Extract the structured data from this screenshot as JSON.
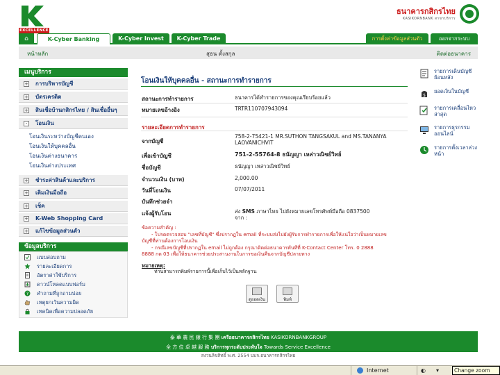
{
  "header": {
    "logo_excellence": "EXCELLENCE",
    "bank_name_th": "ธนาคารกสิกรไทย",
    "bank_name_en": "KASIKORNBANK สาขาบริการ"
  },
  "nav": {
    "tabs": [
      {
        "label": "K-Cyber Banking"
      },
      {
        "label": "K-Cyber Invest"
      },
      {
        "label": "K-Cyber Trade"
      }
    ],
    "edit_settings": "การตั้งค่าข้อมูลส่วนตัว",
    "logout": "ออกจากระบบ"
  },
  "subbar": {
    "home": "หน้าหลัก",
    "user_name": "สุธน ตั้งสกุล",
    "contact": "ติดต่อธนาคาร"
  },
  "sidebar": {
    "services_title": "เมนูบริการ",
    "items": [
      {
        "label": "การบริหารบัญชี",
        "sign": "+"
      },
      {
        "label": "บัตรเครดิต",
        "sign": "+"
      },
      {
        "label": "สินเชื่อบ้านกสิกรไทย / สินเชื่ออื่นๆ",
        "sign": "+"
      },
      {
        "label": "โอนเงิน",
        "sign": "-"
      },
      {
        "label": "ชำระค่าสินค้าและบริการ",
        "sign": "+"
      },
      {
        "label": "เติมเงินมือถือ",
        "sign": "+"
      },
      {
        "label": "เช็ค",
        "sign": "+"
      },
      {
        "label": "K-Web Shopping Card",
        "sign": "+"
      },
      {
        "label": "แก้ไขข้อมูลส่วนตัว",
        "sign": "+"
      }
    ],
    "transfer_sub": [
      "โอนเงินระหว่างบัญชีตนเอง",
      "โอนเงินให้บุคคลอื่น",
      "โอนเงินต่างธนาคาร",
      "โอนเงินต่างประเทศ"
    ],
    "info_title": "ข้อมูลบริการ",
    "info_items": [
      "แบบสอบถาม",
      "รายละเอียดการ",
      "อัตราค่าใช้บริการ",
      "ดาวน์โหลดแบบฟอร์ม",
      "คำถามที่ถูกถามบ่อย",
      "เหตุยกเว้นความผิด",
      "เทคนิคเพื่อความปลอดภัย"
    ]
  },
  "main": {
    "title": "โอนเงินให้บุคคลอื่น - สถานะการทำรายการ",
    "status_label": "สถานะการทำรายการ",
    "status_value": "ธนาคารได้ทำรายการของคุณเรียบร้อยแล้ว",
    "ref_label": "หมายเลขอ้างอิง",
    "ref_value": "TRTR110707943094",
    "details_title": "รายละเอียดการทำรายการ",
    "from_label": "จากบัญชี",
    "from_value": "758-2-75421-1 MR.SUTHON TANGSAKUL and MS.TANANYA LAOVANICHVIT",
    "to_label": "เพื่อเข้าบัญชี",
    "to_value": "751-2-55764-8 ธนัญญา เหล่าวณิชย์วิทย์",
    "name_label": "ชื่อบัญชี",
    "name_value": "ธนัญญา เหล่าวณิชย์วิทย์",
    "amount_label": "จำนวนเงิน (บาท)",
    "amount_value": "2,000.00",
    "date_label": "วันที่โอนเงิน",
    "date_value": "07/07/2011",
    "memo_label": "บันทึกช่วยจำ",
    "memo_value": "",
    "notify_label": "แจ้งผู้รับโอน",
    "notify_value_prefix": "ส่ง",
    "notify_value_sms": "SMS",
    "notify_value_rest": "ภาษาไทย ไปยังหมายเลขโทรศัพท์มือถือ 0837500",
    "notify_value_from": "จาก :",
    "notes_title": "ข้อความสำคัญ :",
    "notes_line1": "- โปรดตรวจสอบ \"เลขที่บัญชี\" ซึ่งปรากฏใน email ที่ระบบส่งไปยังผู้รับการทำรายการเพื่อให้แน่ใจว่าเป็นหมายเลข",
    "notes_line2": "บัญชีที่ท่านต้องการโอนเงิน",
    "notes_line3": "- กรณีเลขบัญชีที่ปรากฏใน email ไม่ถูกต้อง กรุณาติดต่อธนาคารทันทีที่ K-Contact Center โทร. 0 2888",
    "notes_line4": "8888 กด 03 เพื่อให้ธนาคารช่วยประสานงานในการขอเงินคืนจากบัญชีปลายทาง",
    "remark_title": "หมายเหตุ:",
    "remark_text": "ท่านสามารถพิมพ์รายการนี้เพื่อเก็บไว้เป็นหลักฐาน",
    "btn_view": "ดูยอดเงิน",
    "btn_print": "พิมพ์"
  },
  "quick_links": [
    {
      "label": "รายการเดินบัญชีย้อนหลัง",
      "icon": "statement-icon"
    },
    {
      "label": "ยอดเงินในบัญชี",
      "icon": "balance-icon"
    },
    {
      "label": "รายการเคลื่อนไหวล่าสุด",
      "icon": "recent-icon"
    },
    {
      "label": "รายการธุรกรรมออนไลน์",
      "icon": "online-icon"
    },
    {
      "label": "รายการตั้งเวลาล่วงหน้า",
      "icon": "schedule-icon"
    }
  ],
  "footer": {
    "line1_cn": "泰 華 農 民 銀 行 集 團",
    "line1_th": "เครือธนาคารกสิกรไทย",
    "line1_en": "KASIKORNBANKGROUP",
    "line2_cn": "全 方 位 卓 越 服 務",
    "line2_th": "บริการทุกระดับประทับใจ",
    "line2_en": "Towards Service Excellence",
    "copyright": "สงวนลิขสิทธิ์ พ.ศ. 2554 บมจ.ธนาคารกสิกรไทย"
  },
  "statusbar": {
    "zone": "Internet",
    "zoom_tip": "Change zoom level"
  },
  "colors": {
    "brand_green": "#1b8a2c",
    "alert_red": "#c22222",
    "link_blue": "#1b3f7a"
  }
}
